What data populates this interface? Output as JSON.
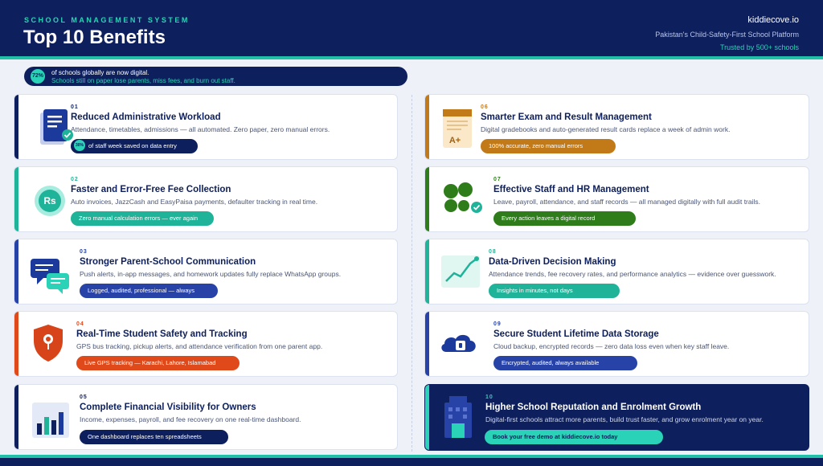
{
  "header": {
    "kicker": "SCHOOL MANAGEMENT SYSTEM",
    "title": "Top 10 Benefits",
    "brand": "kiddiecove.io",
    "tagline": "Pakistan's Child-Safety-First School Platform",
    "trusted": "Trusted by 500+ schools"
  },
  "stat": {
    "badge": "72%",
    "line1": "of schools globally are now digital.",
    "line2": "Schools still on paper lose parents, miss fees, and burn out staff."
  },
  "cards": [
    {
      "num": "01",
      "title": "Reduced Administrative Workload",
      "desc": "Attendance, timetables, admissions — all automated. Zero paper, zero manual errors.",
      "pill": "of staff week saved on data entry",
      "pill_badge": "30%",
      "color": "#0d1f5c",
      "icon": "document-check-icon"
    },
    {
      "num": "02",
      "title": "Faster and Error-Free Fee Collection",
      "desc": "Auto invoices, JazzCash and EasyPaisa payments, defaulter tracking in real time.",
      "pill": "Zero manual calculation errors — ever again",
      "color": "#1fb39a",
      "icon": "rupee-coin-icon",
      "icon_text": "Rs"
    },
    {
      "num": "03",
      "title": "Stronger Parent-School Communication",
      "desc": "Push alerts, in-app messages, and homework updates fully replace WhatsApp groups.",
      "pill": "Logged, audited, professional — always",
      "color": "#2743a8",
      "icon": "chat-bubbles-icon"
    },
    {
      "num": "04",
      "title": "Real-Time Student Safety and Tracking",
      "desc": "GPS bus tracking, pickup alerts, and attendance verification from one parent app.",
      "pill": "Live GPS tracking — Karachi, Lahore, Islamabad",
      "color": "#e0491a",
      "icon": "shield-location-icon"
    },
    {
      "num": "05",
      "title": "Complete Financial Visibility for Owners",
      "desc": "Income, expenses, payroll, and fee recovery on one real-time dashboard.",
      "pill": "One dashboard replaces ten spreadsheets",
      "color": "#0d1f5c",
      "icon": "bar-chart-icon"
    },
    {
      "num": "06",
      "title": "Smarter Exam and Result Management",
      "desc": "Digital gradebooks and auto-generated result cards replace a week of admin work.",
      "pill": "100% accurate, zero manual errors",
      "color": "#c27a18",
      "icon": "report-card-icon",
      "icon_text": "A+"
    },
    {
      "num": "07",
      "title": "Effective Staff and HR Management",
      "desc": "Leave, payroll, attendance, and staff records — all managed digitally with full audit trails.",
      "pill": "Every action leaves a digital record",
      "color": "#2e7d1a",
      "icon": "team-check-icon"
    },
    {
      "num": "08",
      "title": "Data-Driven Decision Making",
      "desc": "Attendance trends, fee recovery rates, and performance analytics — evidence over guesswork.",
      "pill": "Insights in minutes, not days",
      "color": "#1fb39a",
      "icon": "trend-line-icon"
    },
    {
      "num": "09",
      "title": "Secure Student Lifetime Data Storage",
      "desc": "Cloud backup, encrypted records — zero data loss even when key staff leave.",
      "pill": "Encrypted, audited, always available",
      "color": "#2743a8",
      "icon": "cloud-lock-icon"
    },
    {
      "num": "10",
      "title": "Higher School Reputation and Enrolment Growth",
      "desc": "Digital-first schools attract more parents, build trust faster, and grow enrolment year on year.",
      "pill": "Book your free demo at kiddiecove.io today",
      "color": "#2ad3b7",
      "icon": "school-building-icon"
    }
  ]
}
